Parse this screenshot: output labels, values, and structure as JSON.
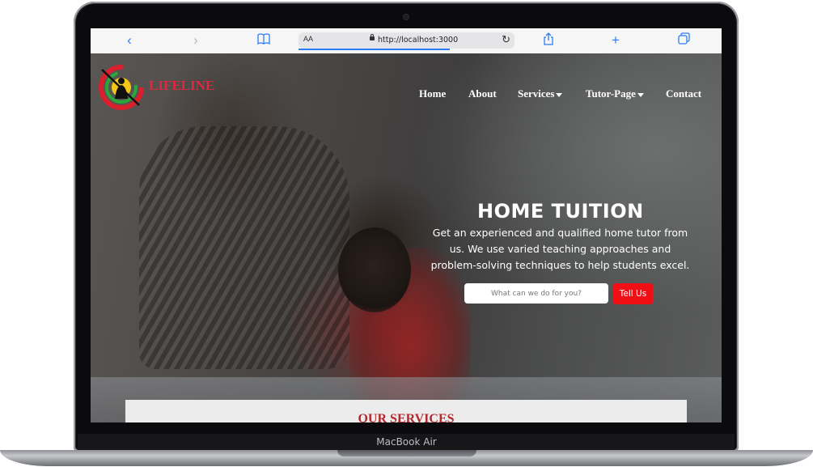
{
  "device": {
    "model": "MacBook Air"
  },
  "browser": {
    "text_size_label": "AA",
    "url": "http://localhost:3000",
    "icons": [
      "back-icon",
      "forward-icon",
      "bookmarks-icon",
      "text-size-icon",
      "lock-icon",
      "reload-icon",
      "share-icon",
      "new-tab-icon",
      "tabs-icon"
    ],
    "accent_color": "#2c7bf6"
  },
  "site": {
    "brand_name": "LIFELINE",
    "brand_color": "#e0283e",
    "nav": {
      "home": "Home",
      "about": "About",
      "services": "Services",
      "tutor_page": "Tutor-Page",
      "contact": "Contact"
    },
    "hero": {
      "title": "HOME TUITION",
      "subtitle": "Get an experienced and qualified home tutor from us. We use varied teaching approaches and problem-solving techniques to help students excel.",
      "search_placeholder": "What can we do for you?",
      "cta_label": "Tell Us",
      "cta_color": "#ef0f14"
    },
    "services_heading": "OUR SERVICES",
    "services_heading_color": "#b3272d"
  }
}
